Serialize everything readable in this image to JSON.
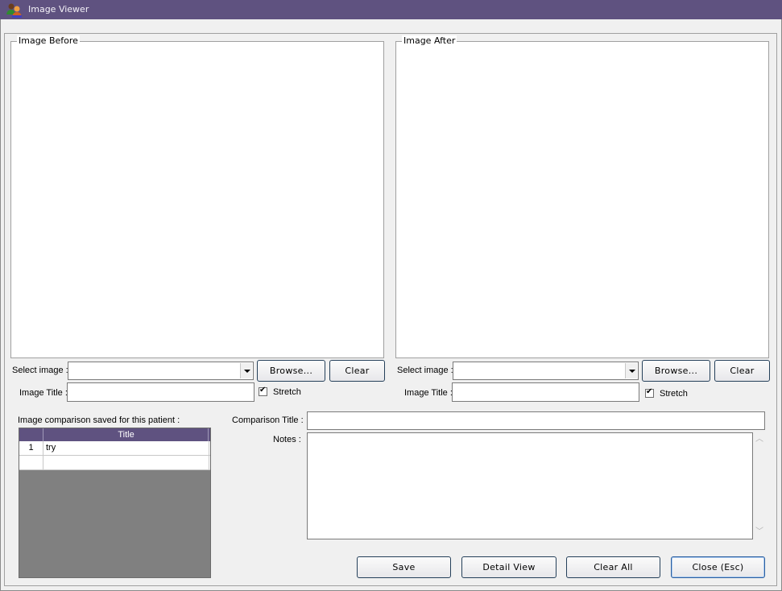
{
  "window": {
    "title": "Image Viewer",
    "icon": "users-icon"
  },
  "before": {
    "group_label": "Image Before",
    "select_label": "Select image :",
    "select_value": "",
    "browse_label": "Browse...",
    "clear_label": "Clear",
    "title_label": "Image Title :",
    "title_value": "",
    "stretch_label": "Stretch",
    "stretch_checked": true
  },
  "after": {
    "group_label": "Image After",
    "select_label": "Select image :",
    "select_value": "",
    "browse_label": "Browse...",
    "clear_label": "Clear",
    "title_label": "Image Title :",
    "title_value": "",
    "stretch_label": "Stretch",
    "stretch_checked": true
  },
  "saved": {
    "label": "Image comparison saved for this patient :",
    "columns": [
      "Title"
    ],
    "rows": [
      {
        "num": "1",
        "title": "try"
      },
      {
        "num": "",
        "title": ""
      }
    ]
  },
  "comparison": {
    "title_label": "Comparison Title :",
    "title_value": "",
    "notes_label": "Notes :",
    "notes_value": ""
  },
  "actions": {
    "save": "Save",
    "detail_view": "Detail View",
    "clear_all": "Clear All",
    "close": "Close (Esc)"
  },
  "colors": {
    "titlebar": "#5f5280",
    "grid_header": "#5f5280",
    "grid_empty": "#808080"
  }
}
